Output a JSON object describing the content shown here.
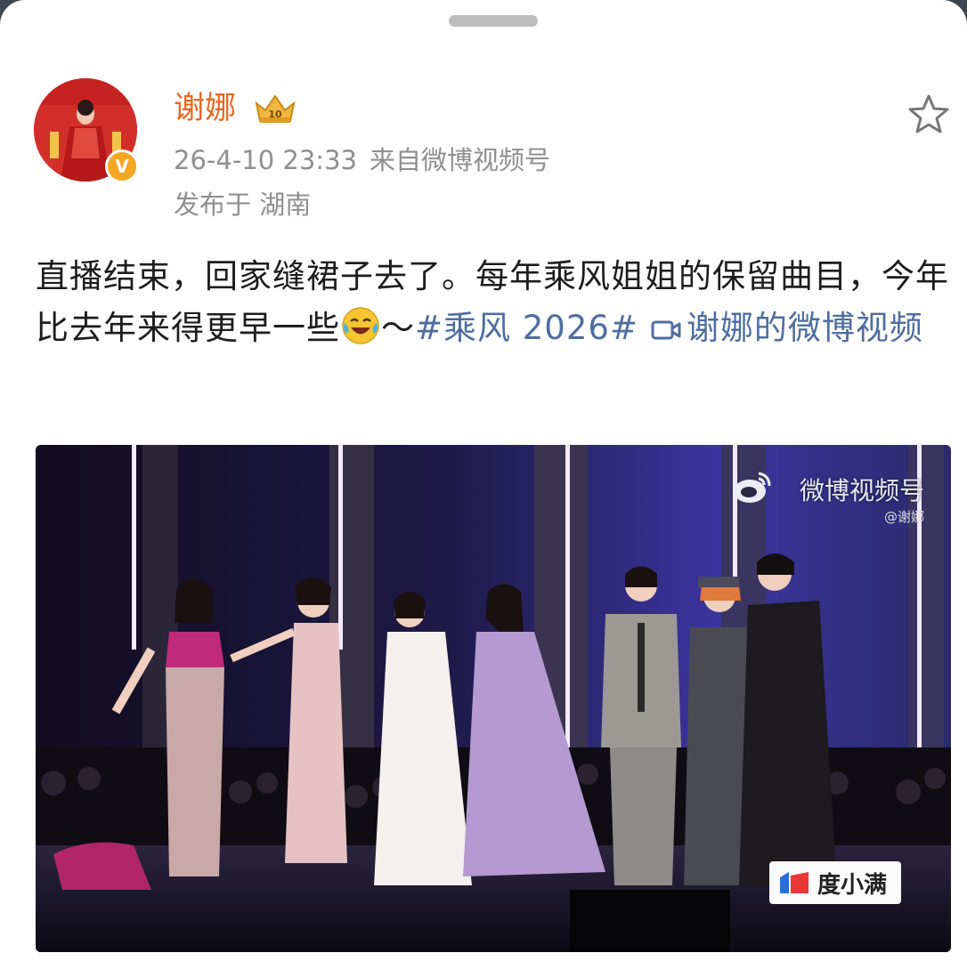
{
  "post": {
    "username": "谢娜",
    "timestamp": "26-4-10 23:33",
    "source": "来自微博视频号",
    "location": "发布于 湖南",
    "text_before_emoji": "直播结束，回家缝裙子去了。每年乘风姐姐的保留曲目，今年比去年来得更早一些",
    "text_after_emoji": "～",
    "hashtag": "#乘风 2026#",
    "video_link": "谢娜的微博视频"
  },
  "video": {
    "watermark": "微博视频号",
    "watermark_handle": "@谢娜",
    "sponsor_logo_text": "度小满"
  },
  "icons": {
    "crown": "crown-icon",
    "star": "star-icon",
    "emoji": "laughing-crying-emoji",
    "video": "video-icon",
    "verified": "verified-badge-icon"
  },
  "colors": {
    "username": "#e86722",
    "link": "#4e6ea0",
    "meta": "#8f8f8f"
  }
}
